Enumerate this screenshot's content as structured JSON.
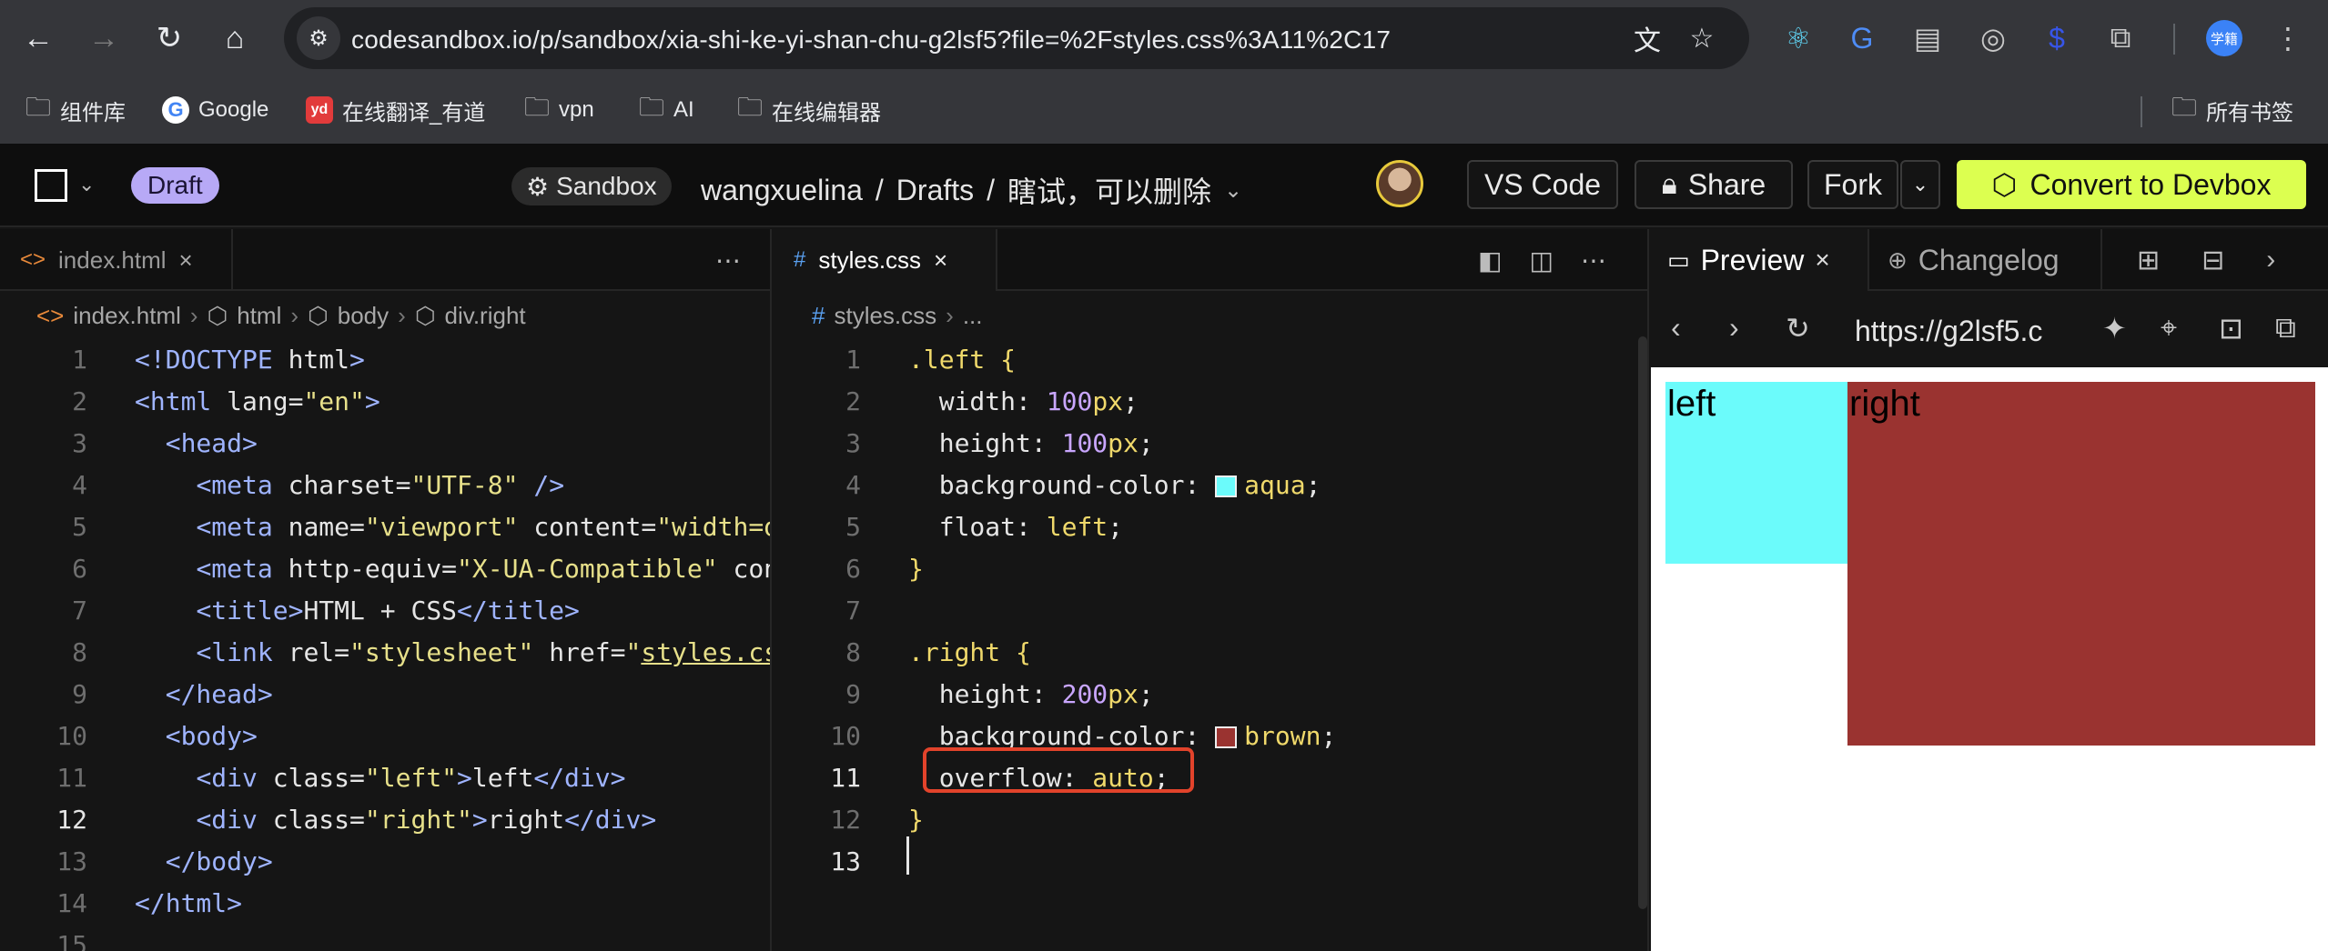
{
  "browser": {
    "url": "codesandbox.io/p/sandbox/xia-shi-ke-yi-shan-chu-g2lsf5?file=%2Fstyles.css%3A11%2C17",
    "bookmarks": [
      "组件库",
      "Google",
      "在线翻译_有道",
      "vpn",
      "AI",
      "在线编辑器"
    ],
    "all_bookmarks": "所有书签",
    "profile_label": "学籍"
  },
  "header": {
    "draft": "Draft",
    "sandbox": "Sandbox",
    "owner": "wangxuelina",
    "slash": "/",
    "folder": "Drafts",
    "title": "瞎试，可以删除",
    "vscode": "VS Code",
    "share": "Share",
    "fork": "Fork",
    "convert": "Convert to Devbox",
    "accent": "#dcff50"
  },
  "left_editor": {
    "tab": "index.html",
    "crumbs": [
      "index.html",
      "html",
      "body",
      "div.right"
    ],
    "lines": [
      "1",
      "2",
      "3",
      "4",
      "5",
      "6",
      "7",
      "8",
      "9",
      "10",
      "11",
      "12",
      "13",
      "14",
      "15"
    ]
  },
  "mid_editor": {
    "tab": "styles.css",
    "crumbs": [
      "styles.css",
      "..."
    ]
  },
  "preview": {
    "tab_preview": "Preview",
    "tab_changelog": "Changelog",
    "url": "https://g2lsf5.c",
    "left_text": "left",
    "right_text": "right",
    "left_color": "#6bfbfb",
    "right_color": "#9a3330"
  }
}
